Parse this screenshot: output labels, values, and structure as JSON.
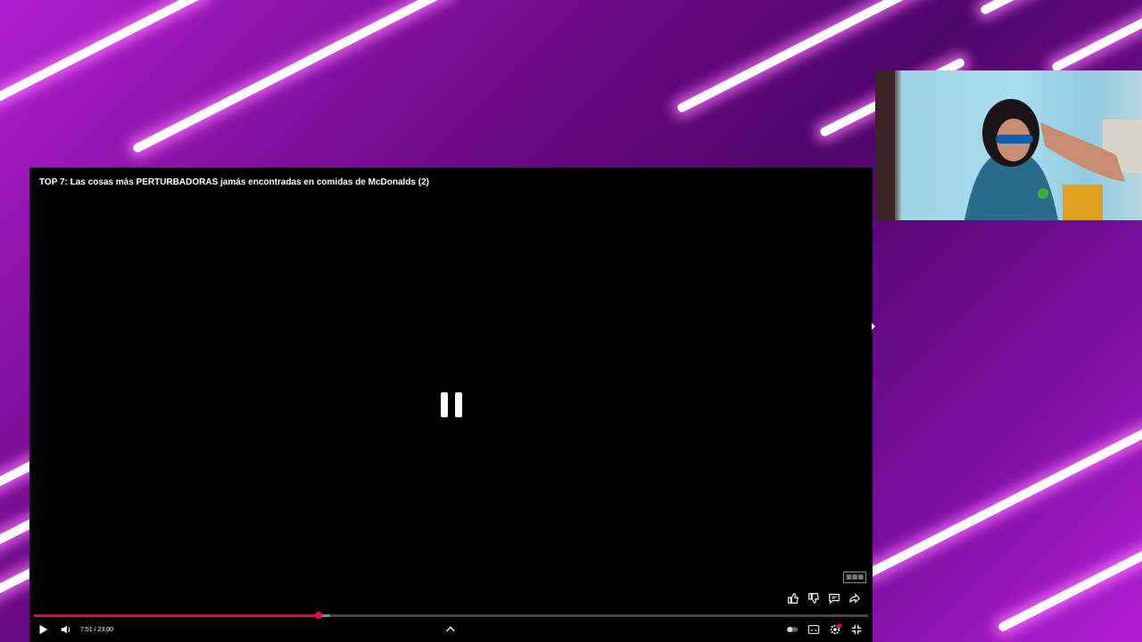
{
  "video": {
    "title": "TOP 7: Las cosas más PERTURBADORAS jamás encontradas en comidas de McDonalds (2)",
    "time_display": "7:51 / 23:00",
    "progress_fraction": 0.341,
    "buffer_fraction": 0.355,
    "state": "paused",
    "watermark_text": "QR/logo"
  },
  "controls": {
    "left": [
      "play-icon",
      "volume-icon"
    ],
    "center": [
      "chevron-up-icon"
    ],
    "right": [
      "autoplay-toggle",
      "subtitles-icon",
      "settings-icon",
      "exit-fullscreen-icon"
    ],
    "side": [
      "like-icon",
      "dislike-icon",
      "comment-icon",
      "share-icon"
    ]
  },
  "colors": {
    "accent": "#f00044",
    "background_primary": "#7a0fa0",
    "stripe": "#ffffff"
  }
}
